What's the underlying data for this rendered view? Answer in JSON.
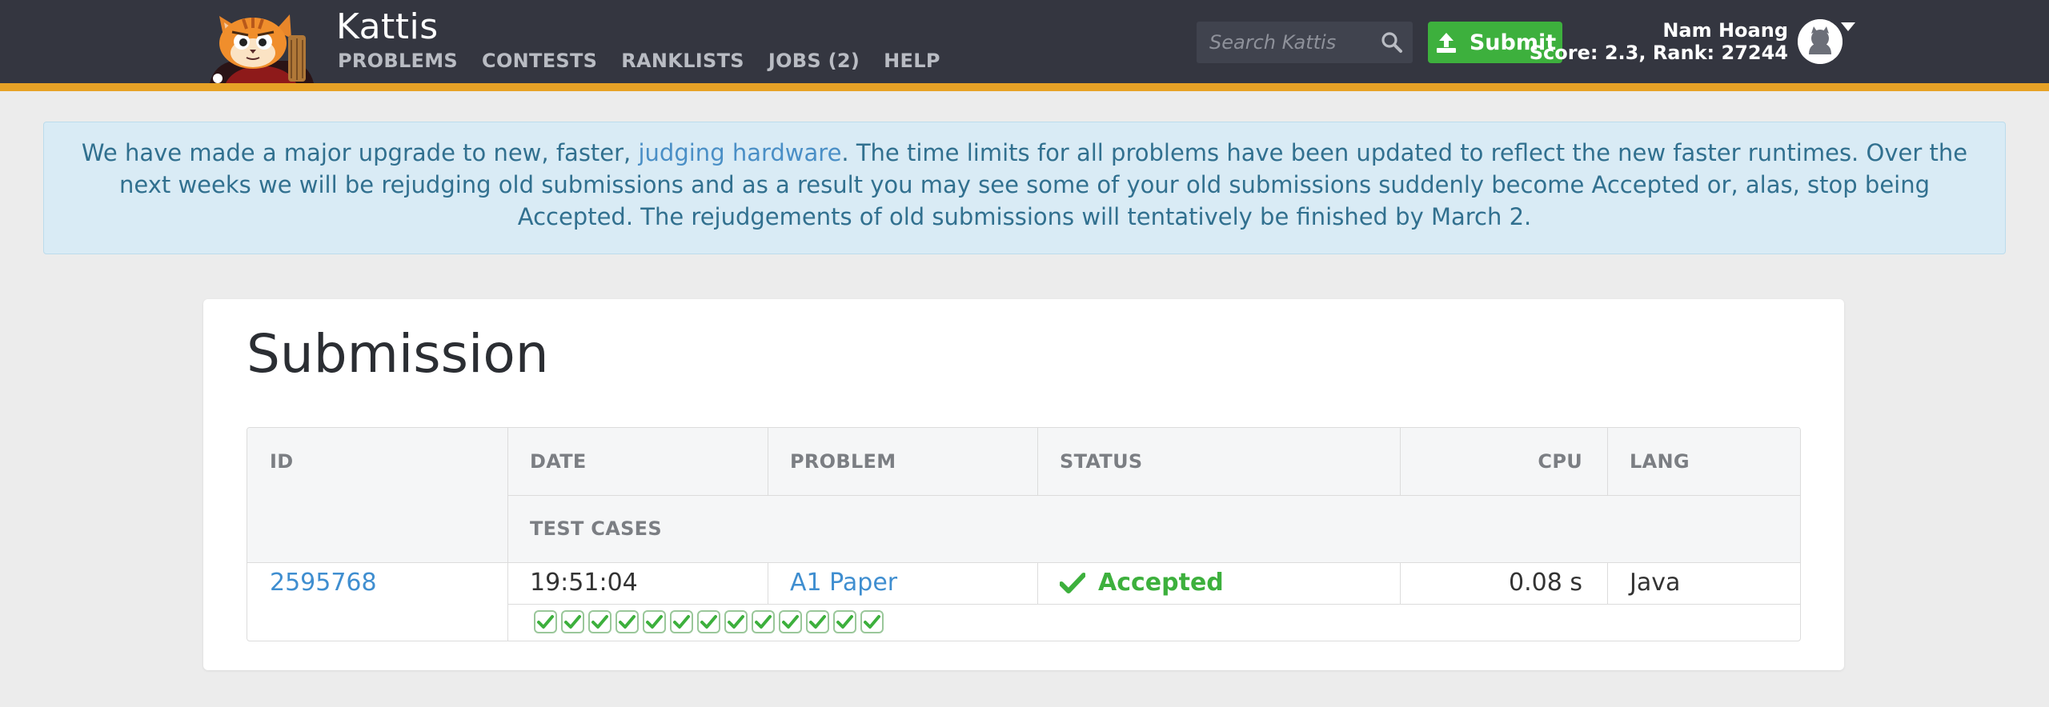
{
  "header": {
    "brand": "Kattis",
    "nav": [
      "PROBLEMS",
      "CONTESTS",
      "RANKLISTS",
      "JOBS (2)",
      "HELP"
    ],
    "search_placeholder": "Search Kattis",
    "submit_label": "Submit",
    "user_name": "Nam Hoang",
    "user_stats": "Score: 2.3, Rank: 27244"
  },
  "alert": {
    "text_before": "We have made a major upgrade to new, faster, ",
    "link_text": "judging hardware",
    "text_after": ". The time limits for all problems have been updated to reflect the new faster runtimes. Over the next weeks we will be rejudging old submissions and as a result you may see some of your old submissions suddenly become Accepted or, alas, stop being Accepted. The rejudgements of old submissions will tentatively be finished by March 2."
  },
  "page_title": "Submission",
  "table": {
    "headers": {
      "id": "ID",
      "date": "DATE",
      "problem": "PROBLEM",
      "status": "STATUS",
      "cpu": "CPU",
      "lang": "LANG",
      "test_cases": "TEST CASES"
    },
    "row": {
      "id": "2595768",
      "date": "19:51:04",
      "problem": "A1 Paper",
      "status": "Accepted",
      "cpu": "0.08 s",
      "lang": "Java",
      "test_cases_passed": 13
    }
  },
  "colors": {
    "topbar": "#343640",
    "accent_stripe": "#e7a226",
    "submit_green": "#3db03d",
    "link_blue": "#3f8ed0",
    "alert_bg": "#d9ebf5"
  }
}
